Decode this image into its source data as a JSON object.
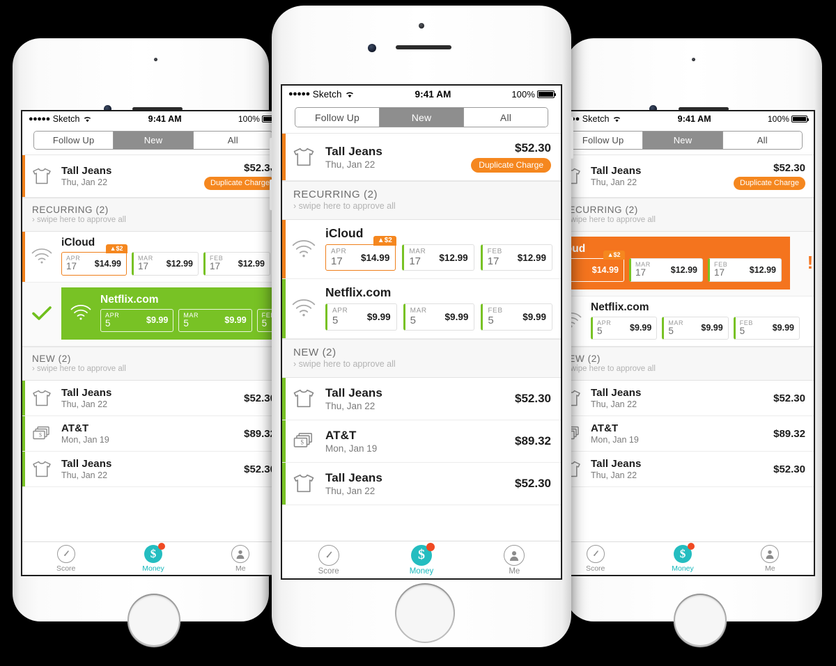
{
  "meta": {
    "bg_color": "#000000",
    "accent_orange": "#f5871f",
    "accent_green": "#78c225",
    "accent_teal": "#24bdc0",
    "badge_red": "#f04a23"
  },
  "statusbar": {
    "dots": "●●●●●",
    "carrier": "Sketch",
    "wifi_icon": "wifi-icon",
    "time": "9:41 AM",
    "battery_pct": "100%"
  },
  "segments": [
    {
      "label": "Follow Up",
      "active": false
    },
    {
      "label": "New",
      "active": true
    },
    {
      "label": "All",
      "active": false
    }
  ],
  "top_row": {
    "icon": "tshirt-icon",
    "name": "Tall Jeans",
    "date": "Thu, Jan 22",
    "amount": "$52.30",
    "flag": "Duplicate Charge",
    "stripe": "orange"
  },
  "recurring_header": {
    "title": "RECURRING (2)",
    "sub": "swipe here to approve all",
    "chevron": "chevron-right-icon"
  },
  "new_header": {
    "title": "NEW (2)",
    "sub": "swipe here to approve all",
    "chevron": "chevron-right-icon"
  },
  "icloud": {
    "icon": "wifi-icon",
    "name": "iCloud",
    "stripe": "orange",
    "badge": "▲$2",
    "chips": [
      {
        "month": "APR",
        "day": "17",
        "amount": "$14.99",
        "highlight": true
      },
      {
        "month": "MAR",
        "day": "17",
        "amount": "$12.99",
        "highlight": false
      },
      {
        "month": "FEB",
        "day": "17",
        "amount": "$12.99",
        "highlight": false
      }
    ]
  },
  "netflix": {
    "icon": "wifi-icon",
    "name": "Netflix.com",
    "stripe": "green",
    "chips": [
      {
        "month": "APR",
        "day": "5",
        "amount": "$9.99",
        "highlight": false
      },
      {
        "month": "MAR",
        "day": "5",
        "amount": "$9.99",
        "highlight": false
      },
      {
        "month": "FEB",
        "day": "5",
        "amount": "$9.99",
        "highlight": false
      }
    ]
  },
  "new_rows": [
    {
      "icon": "tshirt-icon",
      "name": "Tall Jeans",
      "date": "Thu, Jan 22",
      "amount": "$52.30",
      "stripe": "green"
    },
    {
      "icon": "money-stack-icon",
      "name": "AT&T",
      "date": "Mon, Jan 19",
      "amount": "$89.32",
      "stripe": "green"
    },
    {
      "icon": "tshirt-icon",
      "name": "Tall Jeans",
      "date": "Thu, Jan 22",
      "amount": "$52.30",
      "stripe": "green"
    }
  ],
  "tabbar": [
    {
      "label": "Score",
      "icon": "gauge-icon",
      "active": false,
      "badge": false
    },
    {
      "label": "Money",
      "icon": "dollar-circle-icon",
      "active": true,
      "badge": true
    },
    {
      "label": "Me",
      "icon": "person-icon",
      "active": false,
      "badge": false
    }
  ],
  "swipe_states": {
    "approved_symbol": "checkmark-icon",
    "flagged_symbol": "exclamation-icon"
  }
}
